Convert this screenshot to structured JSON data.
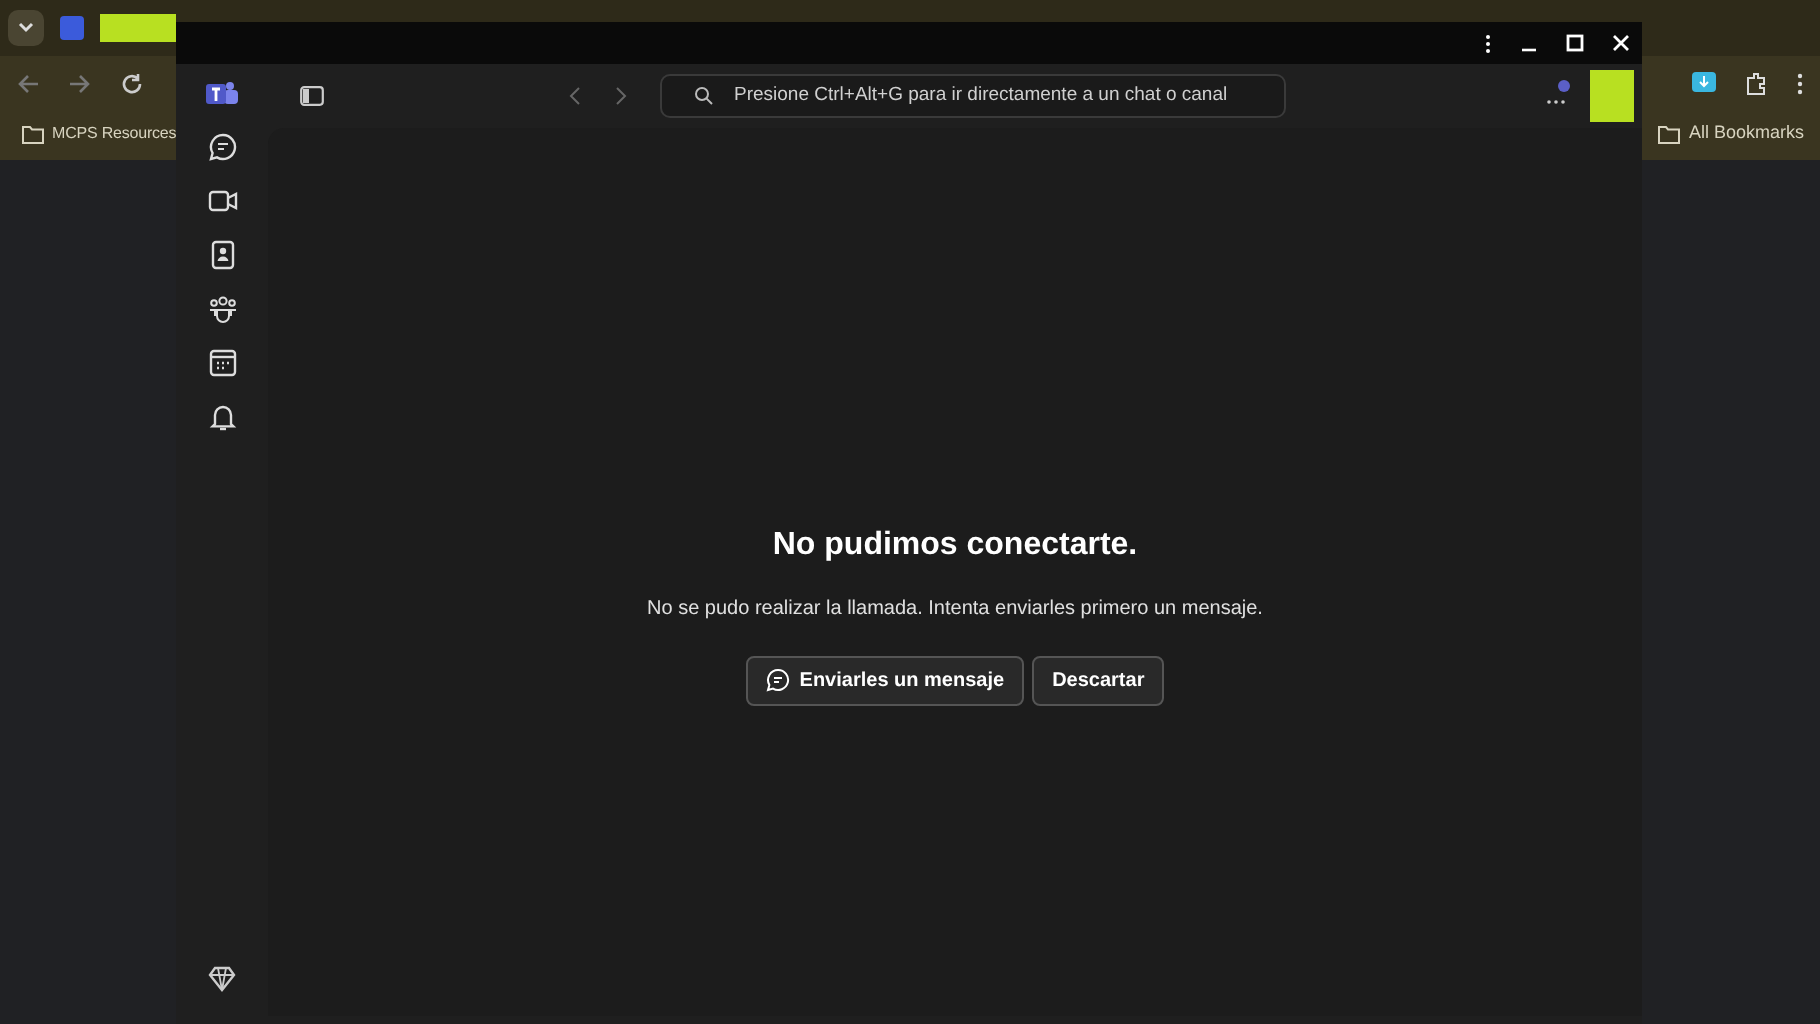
{
  "browser": {
    "bookmarks": [
      {
        "label": "MCPS Resources"
      }
    ],
    "all_bookmarks": "All Bookmarks"
  },
  "teams": {
    "search": {
      "placeholder": "Presione Ctrl+Alt+G para ir directamente a un chat o canal"
    },
    "message": {
      "title": "No pudimos conectarte.",
      "body": "No se pudo realizar la llamada. Intenta enviarles primero un mensaje.",
      "buttons": [
        {
          "label": "Enviarles un mensaje",
          "kind": "chat"
        },
        {
          "label": "Descartar",
          "kind": "plain"
        }
      ]
    }
  }
}
